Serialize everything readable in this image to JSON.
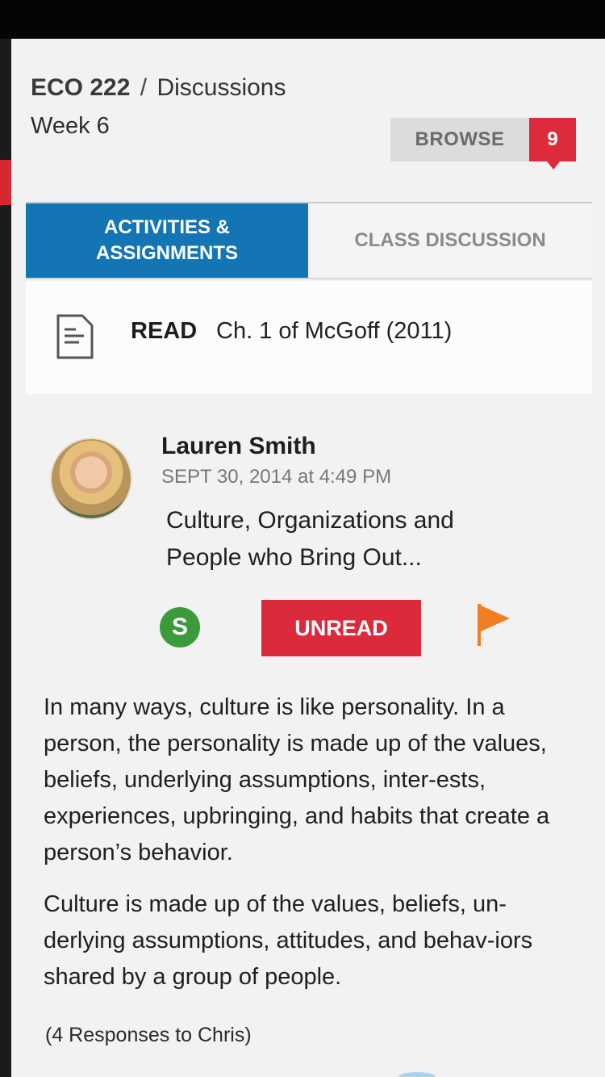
{
  "header": {
    "course": "ECO 222",
    "separator": "/",
    "section": "Discussions",
    "week": "Week 6"
  },
  "browse": {
    "label": "BROWSE",
    "count": "9"
  },
  "tabs": [
    {
      "label": "ACTIVITIES &\nASSIGNMENTS",
      "active": true
    },
    {
      "label": "CLASS DISCUSSION",
      "active": false
    }
  ],
  "read_item": {
    "icon": "document-icon",
    "label": "READ",
    "text": "Ch. 1 of McGoff (2011)"
  },
  "post": {
    "author": "Lauren Smith",
    "timestamp": "SEPT 30, 2014 at 4:49 PM",
    "title": "Culture, Organizations and People who Bring Out...",
    "badge_letter": "S",
    "unread_label": "UNREAD",
    "flag_icon": "flag-icon",
    "paragraphs": [
      "In many ways, culture is like personality. In a person, the personality is made up of the values, beliefs, underlying assumptions, inter-ests, experiences, upbringing, and habits that create a person’s behavior.",
      "Culture is made up of the values, beliefs, un-derlying assumptions, attitudes, and behav-iors shared by a group of people."
    ],
    "responses": "(4 Responses to Chris)"
  },
  "colors": {
    "accent_blue": "#1475b4",
    "alert_red": "#de2b3b",
    "badge_green": "#3c9a3a",
    "flag_orange": "#f07f24"
  }
}
